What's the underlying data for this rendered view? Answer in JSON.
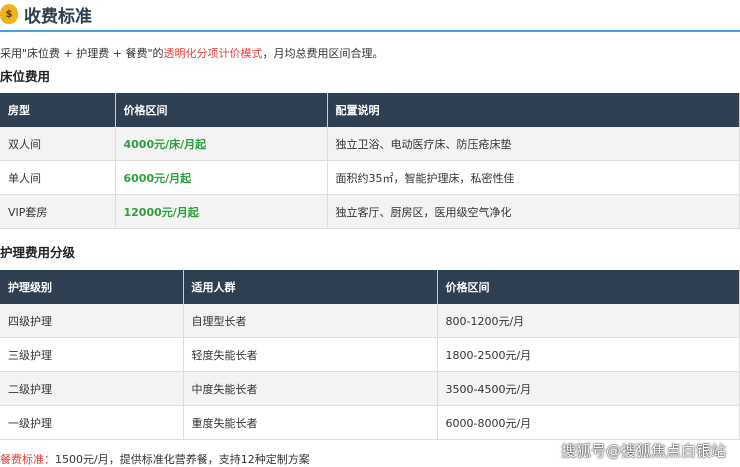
{
  "title": "收费标准",
  "intro": {
    "prefix": "采用\"床位费 + 护理费 + 餐费\"的",
    "highlight": "透明化分项计价模式",
    "suffix": "，月均总费用区间合理。"
  },
  "bed": {
    "heading": "床位费用",
    "headers": [
      "房型",
      "价格区间",
      "配置说明"
    ],
    "rows": [
      [
        "双人间",
        "4000元/床/月起",
        "独立卫浴、电动医疗床、防压疮床垫"
      ],
      [
        "单人间",
        "6000元/月起",
        "面积约35㎡，智能护理床，私密性佳"
      ],
      [
        "VIP套房",
        "12000元/月起",
        "独立客厅、厨房区，医用级空气净化"
      ]
    ]
  },
  "care": {
    "heading": "护理费用分级",
    "headers": [
      "护理级别",
      "适用人群",
      "价格区间"
    ],
    "rows": [
      [
        "四级护理",
        "自理型长者",
        "800-1200元/月"
      ],
      [
        "三级护理",
        "轻度失能长者",
        "1800-2500元/月"
      ],
      [
        "二级护理",
        "中度失能长者",
        "3500-4500元/月"
      ],
      [
        "一级护理",
        "重度失能长者",
        "6000-8000元/月"
      ]
    ]
  },
  "footer": {
    "label": "餐费标准：",
    "text": "1500元/月，提供标准化营养餐，支持12种定制方案"
  },
  "watermark": "搜狐号@搜狐焦点白银站"
}
